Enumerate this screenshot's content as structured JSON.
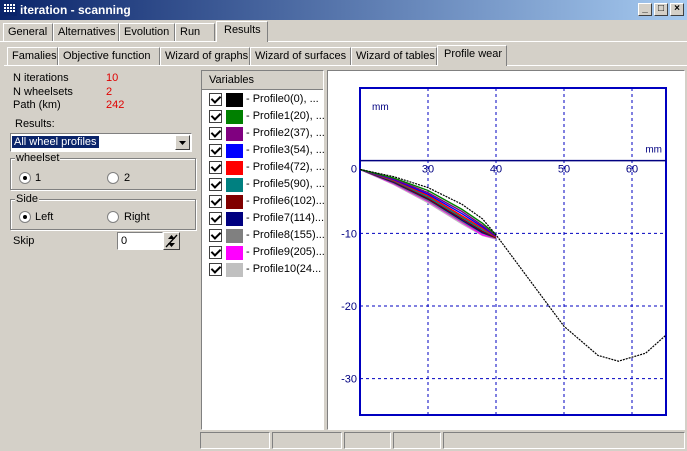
{
  "window": {
    "title": "iteration - scanning"
  },
  "main_tabs": [
    "General",
    "Alternatives",
    "Evolution",
    "Run",
    "Results"
  ],
  "sub_tabs": [
    "Famalies",
    "Objective function",
    "Wizard of graphs",
    "Wizard of surfaces",
    "Wizard of tables",
    "Profile wear"
  ],
  "info": {
    "iterations_label": "N iterations",
    "iterations_value": "10",
    "wheelsets_label": "N wheelsets",
    "wheelsets_value": "2",
    "path_label": "Path (km)",
    "path_value": "242"
  },
  "results": {
    "label": "Results:",
    "selected": "All wheel profiles"
  },
  "wheelset": {
    "label": "wheelset",
    "option1": "1",
    "option2": "2",
    "selected": "1"
  },
  "side": {
    "label": "Side",
    "option1": "Left",
    "option2": "Right",
    "selected": "Left"
  },
  "skip": {
    "label": "Skip",
    "value": "0"
  },
  "variables": {
    "header": "Variables",
    "items": [
      {
        "label": "- Profile0(0), ...",
        "color": "#000000"
      },
      {
        "label": "- Profile1(20), ...",
        "color": "#008000"
      },
      {
        "label": "- Profile2(37), ...",
        "color": "#800080"
      },
      {
        "label": "- Profile3(54), ...",
        "color": "#0000ff"
      },
      {
        "label": "- Profile4(72), ...",
        "color": "#ff0000"
      },
      {
        "label": "- Profile5(90), ...",
        "color": "#008080"
      },
      {
        "label": "- Profile6(102)...",
        "color": "#800000"
      },
      {
        "label": "- Profile7(114)...",
        "color": "#000080"
      },
      {
        "label": "- Profile8(155)...",
        "color": "#808080"
      },
      {
        "label": "- Profile9(205)...",
        "color": "#ff00ff"
      },
      {
        "label": "- Profile10(24...",
        "color": "#c0c0c0"
      }
    ]
  },
  "chart_data": {
    "type": "line",
    "xlabel": "mm",
    "ylabel": "mm",
    "xlim": [
      20,
      65
    ],
    "ylim": [
      -35,
      10
    ],
    "x_ticks": [
      30,
      40,
      50,
      60
    ],
    "y_ticks": [
      0,
      -10,
      -20,
      -30
    ],
    "grid": true,
    "series": [
      {
        "x": [
          20,
          25,
          30,
          35,
          38,
          40,
          45,
          50,
          55,
          58,
          62,
          65
        ],
        "y": [
          -1.2,
          -2.2,
          -3.7,
          -6.0,
          -8.0,
          -10.2,
          -16.5,
          -22.8,
          -26.8,
          -27.6,
          -26.5,
          -24.0
        ]
      },
      {
        "x": [
          20,
          25,
          30,
          35,
          38,
          40
        ],
        "y": [
          -1.2,
          -2.4,
          -4.1,
          -6.7,
          -8.6,
          -10.2
        ]
      },
      {
        "x": [
          20,
          25,
          30,
          35,
          38,
          40
        ],
        "y": [
          -1.2,
          -2.5,
          -4.4,
          -7.0,
          -8.9,
          -10.3
        ]
      },
      {
        "x": [
          20,
          25,
          30,
          35,
          38,
          40
        ],
        "y": [
          -1.2,
          -2.6,
          -4.6,
          -7.3,
          -9.1,
          -10.4
        ]
      },
      {
        "x": [
          20,
          25,
          30,
          35,
          38,
          40
        ],
        "y": [
          -1.2,
          -2.7,
          -4.8,
          -7.6,
          -9.3,
          -10.5
        ]
      },
      {
        "x": [
          20,
          25,
          30,
          35,
          38,
          40
        ],
        "y": [
          -1.2,
          -2.8,
          -5.0,
          -7.8,
          -9.5,
          -10.5
        ]
      },
      {
        "x": [
          20,
          25,
          30,
          35,
          38,
          40
        ],
        "y": [
          -1.2,
          -2.9,
          -5.2,
          -8.0,
          -9.7,
          -10.6
        ]
      },
      {
        "x": [
          20,
          25,
          30,
          35,
          38,
          40
        ],
        "y": [
          -1.2,
          -3.0,
          -5.3,
          -8.2,
          -9.9,
          -10.6
        ]
      },
      {
        "x": [
          20,
          25,
          30,
          35,
          38,
          40
        ],
        "y": [
          -1.2,
          -3.1,
          -5.5,
          -8.4,
          -10.0,
          -10.7
        ]
      },
      {
        "x": [
          20,
          25,
          30,
          35,
          38,
          40
        ],
        "y": [
          -1.2,
          -3.2,
          -5.6,
          -8.5,
          -10.2,
          -10.7
        ]
      },
      {
        "x": [
          20,
          25,
          30,
          35,
          38,
          40
        ],
        "y": [
          -1.2,
          -3.3,
          -5.8,
          -8.7,
          -10.3,
          -10.8
        ]
      }
    ]
  }
}
